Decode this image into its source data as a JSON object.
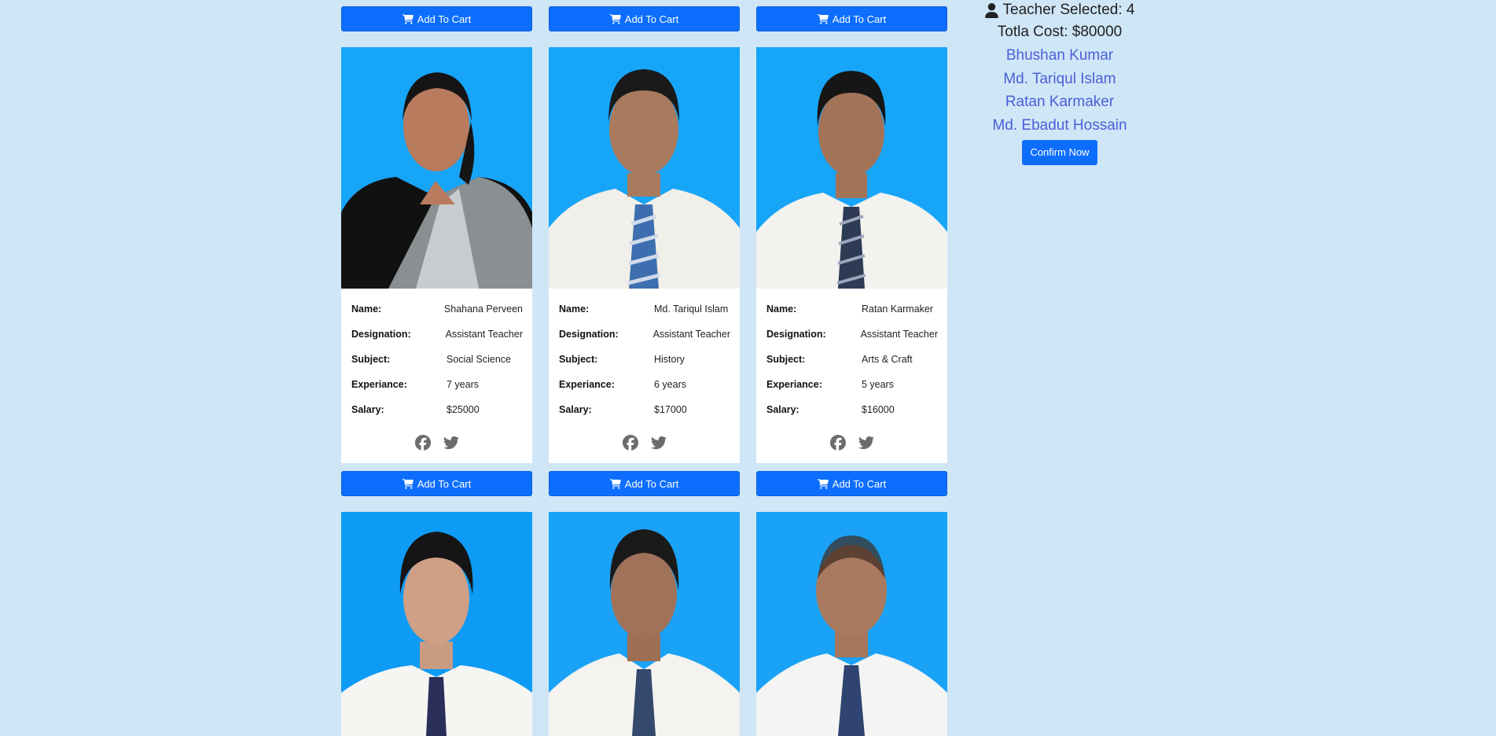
{
  "buttons": {
    "add_to_cart": "Add To Cart",
    "confirm": "Confirm Now"
  },
  "cart": {
    "selected_label": "Teacher Selected: 4",
    "cost_label": "Totla Cost: $80000",
    "names": [
      "Bhushan Kumar",
      "Md. Tariqul Islam",
      "Ratan Karmaker",
      "Md. Ebadut Hossain"
    ]
  },
  "fields": {
    "name": "Name:",
    "designation": "Designation:",
    "subject": "Subject:",
    "experience": "Experiance:",
    "salary": "Salary:"
  },
  "teachers": [
    {
      "name": "Shahana Perveen",
      "designation": "Assistant Teacher",
      "subject": "Social Science",
      "experience": "7 years",
      "salary": "$25000"
    },
    {
      "name": "Md. Tariqul Islam",
      "designation": "Assistant Teacher",
      "subject": "History",
      "experience": "6 years",
      "salary": "$17000"
    },
    {
      "name": "Ratan Karmaker",
      "designation": "Assistant Teacher",
      "subject": "Arts & Craft",
      "experience": "5 years",
      "salary": "$16000"
    }
  ],
  "icons": {
    "cart": "shopping-cart-icon",
    "user": "user-icon",
    "facebook": "facebook-icon",
    "twitter": "twitter-icon"
  },
  "colors": {
    "background": "#cfe6f7",
    "primary": "#0d6efd",
    "photo_bg": "#17a5f8",
    "name_link": "#4a5fd6"
  }
}
